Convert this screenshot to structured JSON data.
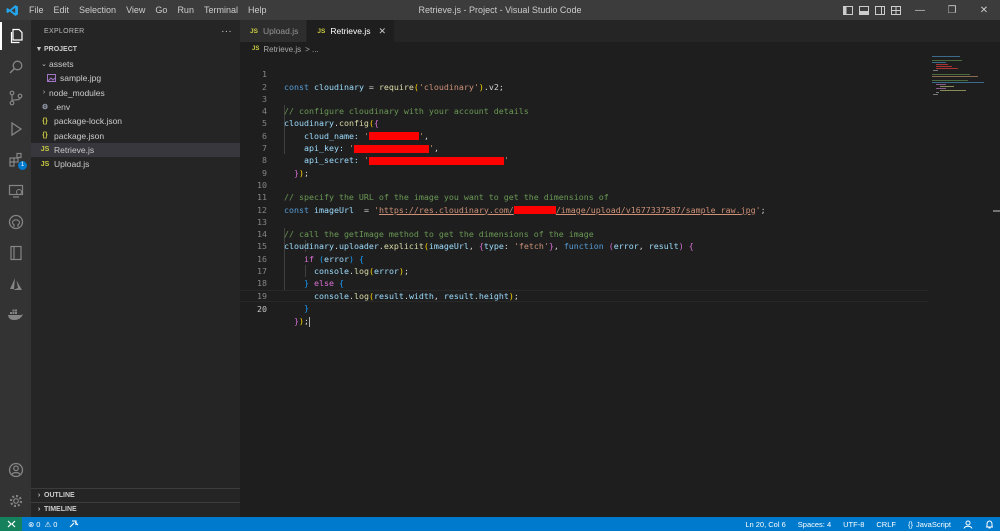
{
  "titlebar": {
    "menu": [
      "File",
      "Edit",
      "Selection",
      "View",
      "Go",
      "Run",
      "Terminal",
      "Help"
    ],
    "title": "Retrieve.js - Project - Visual Studio Code",
    "minimize": "—",
    "maximize": "❐",
    "close": "✕"
  },
  "activitybar": {
    "extensions_badge": "1"
  },
  "sidebar": {
    "header": "EXPLORER",
    "more": "···",
    "project": "PROJECT",
    "items": [
      {
        "label": "assets",
        "type": "folder-open",
        "depth": 1
      },
      {
        "label": "sample.jpg",
        "type": "image",
        "depth": 2
      },
      {
        "label": "node_modules",
        "type": "folder",
        "depth": 1
      },
      {
        "label": ".env",
        "type": "gear",
        "depth": 1
      },
      {
        "label": "package-lock.json",
        "type": "json",
        "depth": 1
      },
      {
        "label": "package.json",
        "type": "json",
        "depth": 1
      },
      {
        "label": "Retrieve.js",
        "type": "js",
        "depth": 1,
        "selected": true
      },
      {
        "label": "Upload.js",
        "type": "js",
        "depth": 1
      }
    ],
    "outline": "OUTLINE",
    "timeline": "TIMELINE"
  },
  "tabs": [
    {
      "label": "Upload.js",
      "active": false
    },
    {
      "label": "Retrieve.js",
      "active": true
    }
  ],
  "breadcrumb": {
    "file": "Retrieve.js",
    "rest": "> ..."
  },
  "editor": {
    "line_numbers": [
      "1",
      "2",
      "3",
      "4",
      "5",
      "6",
      "7",
      "8",
      "9",
      "10",
      "11",
      "12",
      "13",
      "14",
      "15",
      "16",
      "17",
      "18",
      "19",
      "20"
    ],
    "current_line": 20,
    "code": {
      "l1": {
        "kw": "const",
        "var": "cloudinary",
        "eq": " = ",
        "fn": "require",
        "str": "'cloudinary'",
        "tail": ".v2;"
      },
      "l3": "// configure cloudinary with your account details",
      "l4": {
        "obj": "cloudinary",
        "fn": "config"
      },
      "l5": "cloud_name:",
      "l6": "api_key:",
      "l7": "api_secret:",
      "l10": "// specify the URL of the image you want to get the dimensions of",
      "l11": {
        "kw": "const",
        "var": "imageUrl",
        "eq": "  = ",
        "url_start": "https://res.cloudinary.com/",
        "url_end": "/image/upload/v1677337587/sample_raw.jpg"
      },
      "l13": "// call the getImage method to get the dimensions of the image",
      "l14": {
        "obj": "cloudinary",
        "p1": "uploader",
        "fn": "explicit",
        "arg1": "imageUrl",
        "key": "type",
        "str": "'fetch'",
        "kw": "function",
        "p_err": "error",
        "p_res": "result"
      },
      "l15": {
        "kw": "if",
        "var": "error"
      },
      "l16": {
        "obj": "console",
        "fn": "log",
        "var": "error"
      },
      "l17": {
        "kw": "else"
      },
      "l18": {
        "obj": "console",
        "fn": "log",
        "a": "result",
        "b": "width",
        "c": "result",
        "d": "height"
      }
    }
  },
  "statusbar": {
    "errors": "0",
    "warnings": "0",
    "position": "Ln 20, Col 6",
    "spaces": "Spaces: 4",
    "encoding": "UTF-8",
    "eol": "CRLF",
    "language": "JavaScript"
  },
  "colors": {
    "accent": "#007acc",
    "redaction": "#ff0000"
  }
}
